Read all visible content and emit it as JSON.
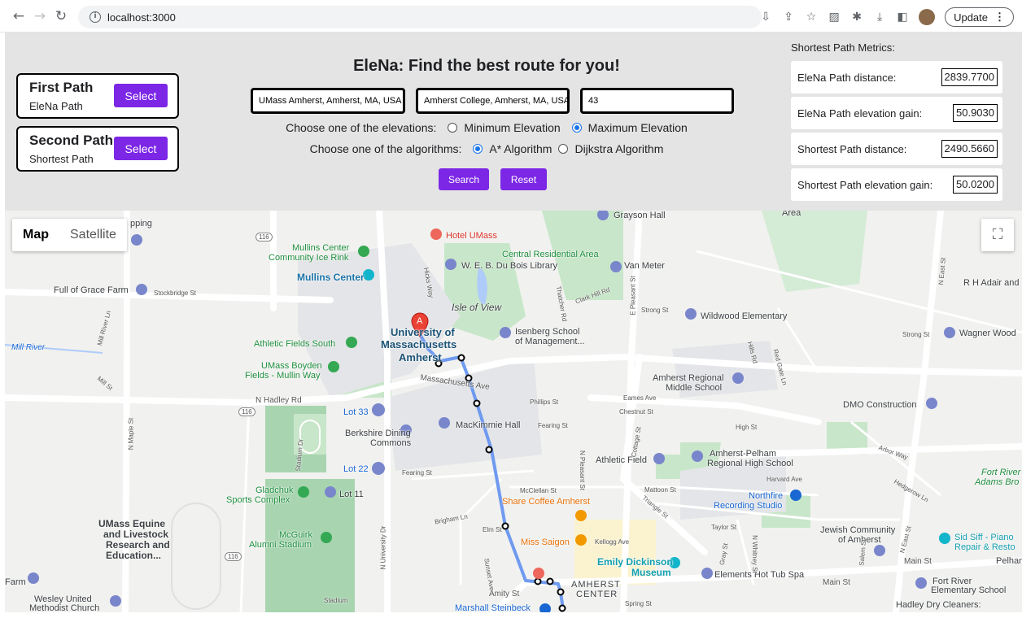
{
  "browser": {
    "url": "localhost:3000",
    "update_label": "Update",
    "icons": [
      "back-icon",
      "forward-icon",
      "reload-icon",
      "info-icon",
      "install-icon",
      "share-icon",
      "star-icon",
      "extension-icon",
      "puzzle-icon",
      "download-icon",
      "sidepanel-icon",
      "profile-avatar",
      "more-icon"
    ]
  },
  "app": {
    "title": "EleNa: Find the best route for you!",
    "paths": [
      {
        "title": "First Path",
        "subtitle": "EleNa Path",
        "button": "Select"
      },
      {
        "title": "Second Path",
        "subtitle": "Shortest Path",
        "button": "Select"
      }
    ],
    "inputs": {
      "source": "UMass Amherst, Amherst, MA, USA",
      "destination": "Amherst College, Amherst, MA, USA",
      "percent": "43"
    },
    "elevation": {
      "label": "Choose one of the elevations:",
      "options": [
        "Minimum Elevation",
        "Maximum Elevation"
      ],
      "selected": "Maximum Elevation"
    },
    "algorithm": {
      "label": "Choose one of the algorithms:",
      "options": [
        "A* Algorithm",
        "Dijkstra Algorithm"
      ],
      "selected": "A* Algorithm"
    },
    "search_label": "Search",
    "reset_label": "Reset",
    "accent": "#7c27e6"
  },
  "metrics": {
    "title": "Shortest Path Metrics:",
    "items": [
      {
        "label": "EleNa Path distance:",
        "value": "2839.7700"
      },
      {
        "label": "EleNa Path elevation gain:",
        "value": "50.9030"
      },
      {
        "label": "Shortest Path distance:",
        "value": "2490.5660"
      },
      {
        "label": "Shortest Path elevation gain:",
        "value": "50.0200"
      }
    ]
  },
  "map": {
    "type_options": [
      "Map",
      "Satellite"
    ],
    "selected_type": "Map",
    "marker_label": "A",
    "route_color": "#6f9af0",
    "labels": {
      "hotel_umass": "Hotel UMass",
      "grayson_hall": "Grayson Hall",
      "area_top": "Area",
      "pping": "pping",
      "mullins_ice_1": "Mullins Center",
      "mullins_ice_2": "Community Ice Rink",
      "mullins_center": "Mullins Center",
      "central_res": "Central Residential Area",
      "du_bois": "W. E. B. Du Bois Library",
      "van_meter": "Van Meter",
      "full_grace": "Full of Grace Farm",
      "isle_view": "Isle of View",
      "wildwood": "Wildwood Elementary",
      "umass_1": "University of",
      "umass_2": "Massachusetts",
      "umass_3": "Amherst",
      "isenberg_1": "Isenberg School",
      "isenberg_2": "of Management...",
      "athletic_south": "Athletic Fields South",
      "wagner": "Wagner Wood",
      "mill_river": "Mill River",
      "boyden_1": "UMass Boyden",
      "boyden_2": "Fields - Mullin Way",
      "regional_ms_1": "Amherst Regional",
      "regional_ms_2": "Middle School",
      "lot33": "Lot 33",
      "dmo": "DMO Construction",
      "mackimmie": "MacKimmie Hall",
      "berkshire_1": "Berkshire Dining",
      "berkshire_2": "Commons",
      "lot22": "Lot 22",
      "athletic_field": "Athletic Field",
      "ap_hs_1": "Amherst-Pelham",
      "ap_hs_2": "Regional High School",
      "gladchuk_1": "Gladchuk",
      "gladchuk_2": "Sports Complex",
      "lot11": "Lot 11",
      "share_coffee": "Share Coffee Amherst",
      "northfire_1": "Northfire",
      "northfire_2": "Recording Studio",
      "fort_river_1": "Fort River",
      "fort_river_2": "Adams Bro",
      "equine_1": "UMass Equine",
      "equine_2": "and Livestock",
      "equine_3": "Research and",
      "equine_4": "Education...",
      "mcguirk_1": "McGuirk",
      "mcguirk_2": "Alumni Stadium",
      "miss_saigon": "Miss Saigon",
      "jewish_1": "Jewish Community",
      "jewish_2": "of Amherst",
      "sid_siff_1": "Sid Siff - Piano",
      "sid_siff_2": "Repair & Resto",
      "dickinson_1": "Emily Dickinson",
      "dickinson_2": "Museum",
      "elements": "Elements Hot Tub Spa",
      "pelham": "Pelham",
      "farm": "Farm",
      "wesley_1": "Wesley United",
      "wesley_2": "Methodist Church",
      "amherst_center_1": "AMHERST",
      "amherst_center_2": "CENTER",
      "marshall": "Marshall Steinbeck",
      "fort_river_elem_1": "Fort River",
      "fort_river_elem_2": "Elementary School",
      "hadley_dry": "Hadley Dry Cleaners:",
      "r_h_adair": "R H Adair and"
    },
    "roads": {
      "stockbridge": "Stockbridge St",
      "n_hadley": "N Hadley Rd",
      "massachusetts_ave": "Massachusetts Ave",
      "e_pleasant": "E Pleasant St",
      "strong_1": "Strong St",
      "strong_2": "Strong St",
      "n_maple": "N Maple St",
      "mill_river_ln": "Mill River Ln",
      "mill_st": "Mill St",
      "eames": "Eames Ave",
      "chestnut": "Chestnut St",
      "phillips": "Phillips St",
      "fearing_1": "Fearing St",
      "fearing_2": "Fearing St",
      "high": "High St",
      "arbor": "Arbor Way",
      "harvard": "Harvard Ave",
      "hedgerow": "Hedgerow Ln",
      "mattoon": "Mattoon St",
      "mcclellan": "McClellan St",
      "triangle": "Triangle St",
      "taylor": "Taylor St",
      "brigham": "Brigham Ln",
      "elm": "Elm St",
      "kellogg": "Kellogg Ave",
      "main_1": "Main St",
      "main_2": "Main St",
      "amity": "Amity St",
      "spring": "Spring St",
      "n_university": "N University Dr",
      "stadium_dr": "Stadium Dr",
      "clark_hill": "Clark Hill Rd",
      "hicks": "Hicks Way",
      "thatcher": "Thatcher Rd",
      "n_east": "N East St",
      "cottage": "Cottage St",
      "n_pleasant": "N Pleasant St",
      "sunset": "Sunset Ave",
      "hills_rd": "Hills Rd",
      "red_gate": "Red Gate Ln",
      "gray": "Gray St",
      "n_whitney": "N Whitney St",
      "salem": "Salem St",
      "n_east_2": "N East St",
      "route116_1": "116",
      "route116_2": "116",
      "route116_3": "116",
      "stadium": "Stadium"
    }
  }
}
